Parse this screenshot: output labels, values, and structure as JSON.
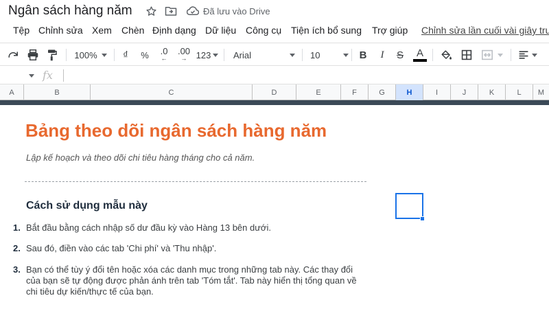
{
  "title_bar": {
    "doc_title": "Ngân sách hàng năm",
    "saved_status": "Đã lưu vào Drive"
  },
  "menu": {
    "items": [
      "Tệp",
      "Chỉnh sửa",
      "Xem",
      "Chèn",
      "Định dạng",
      "Dữ liệu",
      "Công cụ",
      "Tiện ích bổ sung",
      "Trợ giúp"
    ],
    "last_edit": "Chỉnh sửa lần cuối vài giây trước"
  },
  "toolbar": {
    "zoom": "100%",
    "currency": "₫",
    "percent": "%",
    "dec_decrease": ".0",
    "dec_increase": ".00",
    "format_more": "123",
    "font": "Arial",
    "font_size": "10",
    "bold": "B",
    "italic": "I",
    "strike": "S",
    "text_color_letter": "A",
    "text_color": "#000000"
  },
  "formula_bar": {
    "fx_label": "fx",
    "value": ""
  },
  "columns": [
    "A",
    "B",
    "C",
    "D",
    "E",
    "F",
    "G",
    "H",
    "I",
    "J",
    "K",
    "L",
    "M"
  ],
  "selected_column": "H",
  "sheet": {
    "title": "Bảng theo dõi ngân sách hàng năm",
    "subtitle": "Lập kế hoạch và theo dõi chi tiêu hàng tháng cho cả năm.",
    "howto_heading": "Cách sử dụng mẫu này",
    "steps": [
      {
        "num": "1.",
        "text": "Bắt đầu bằng cách nhập số dư đầu kỳ vào Hàng 13 bên dưới."
      },
      {
        "num": "2.",
        "text": "Sau đó, điền vào các tab 'Chi phí' và 'Thu nhập'."
      },
      {
        "num": "3.",
        "text": "Bạn có thể tùy ý đổi tên hoặc xóa các danh mục trong những tab này. Các thay đổi của bạn sẽ tự động được phản ánh trên tab 'Tóm tắt'. Tab này hiển thị tổng quan về chi tiêu dự kiến/thực tế của bạn."
      }
    ]
  },
  "colors": {
    "title_orange": "#e8692f",
    "frozen_bar": "#3b4957",
    "selection_blue": "#1a73e8"
  }
}
